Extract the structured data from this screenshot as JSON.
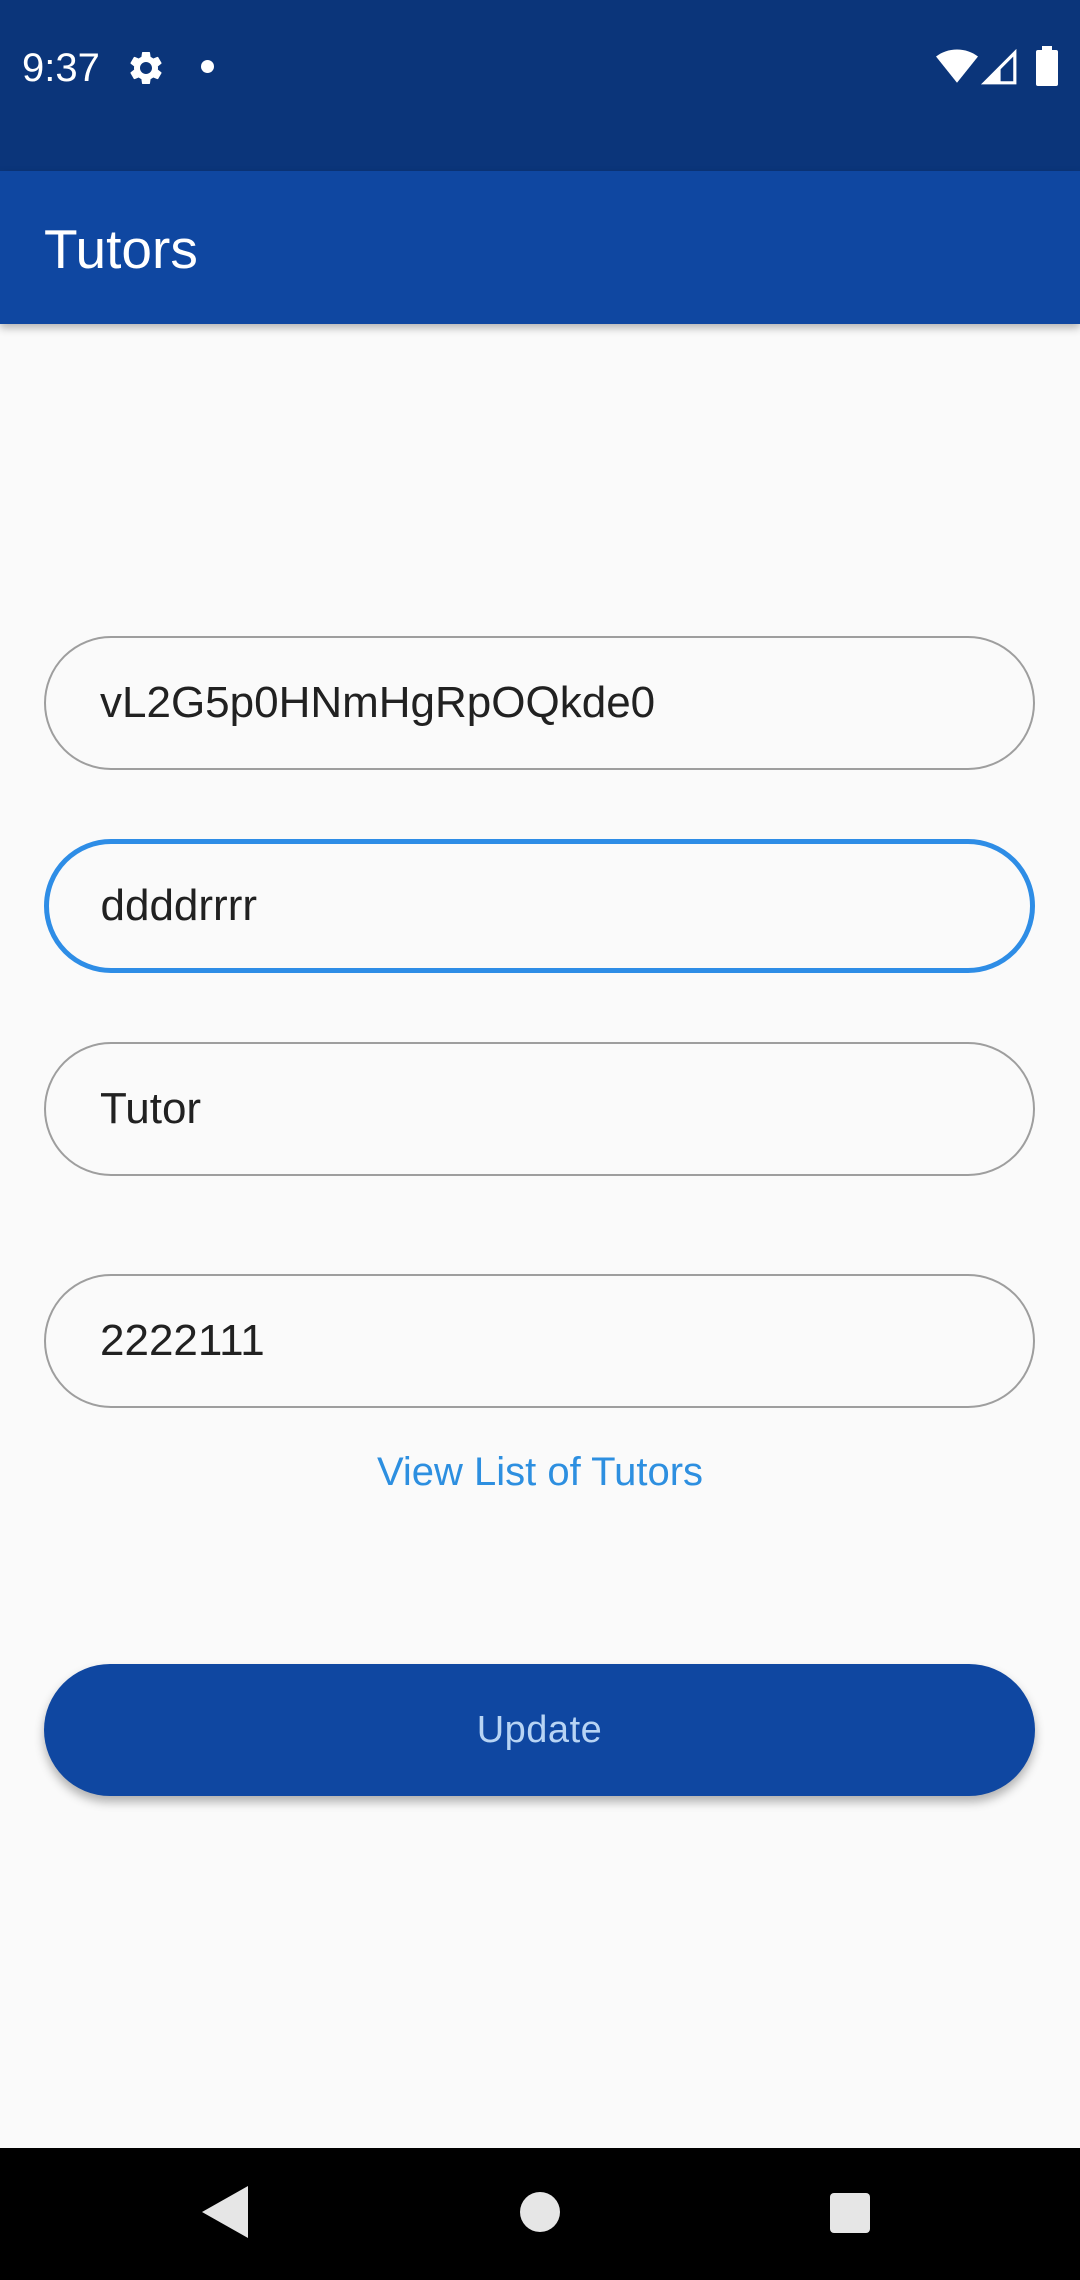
{
  "status_bar": {
    "time": "9:37",
    "icons": [
      "gear-icon",
      "dot-icon",
      "wifi-icon",
      "signal-icon",
      "battery-icon"
    ]
  },
  "app_bar": {
    "title": "Tutors",
    "color": "#0f47a1"
  },
  "form": {
    "fields": [
      {
        "value": "vL2G5p0HNmHgRpOQkde0",
        "focused": false
      },
      {
        "value": "ddddrrrr",
        "focused": true
      },
      {
        "value": "Tutor",
        "focused": false
      },
      {
        "value": "2222111",
        "focused": false
      }
    ],
    "link_label": "View List of Tutors",
    "update_label": "Update"
  },
  "colors": {
    "status_bar": "#0b357a",
    "accent": "#2e8de6",
    "background": "#fafafa"
  },
  "nav_bar": {
    "icons": [
      "back-icon",
      "home-icon",
      "recents-icon"
    ]
  }
}
